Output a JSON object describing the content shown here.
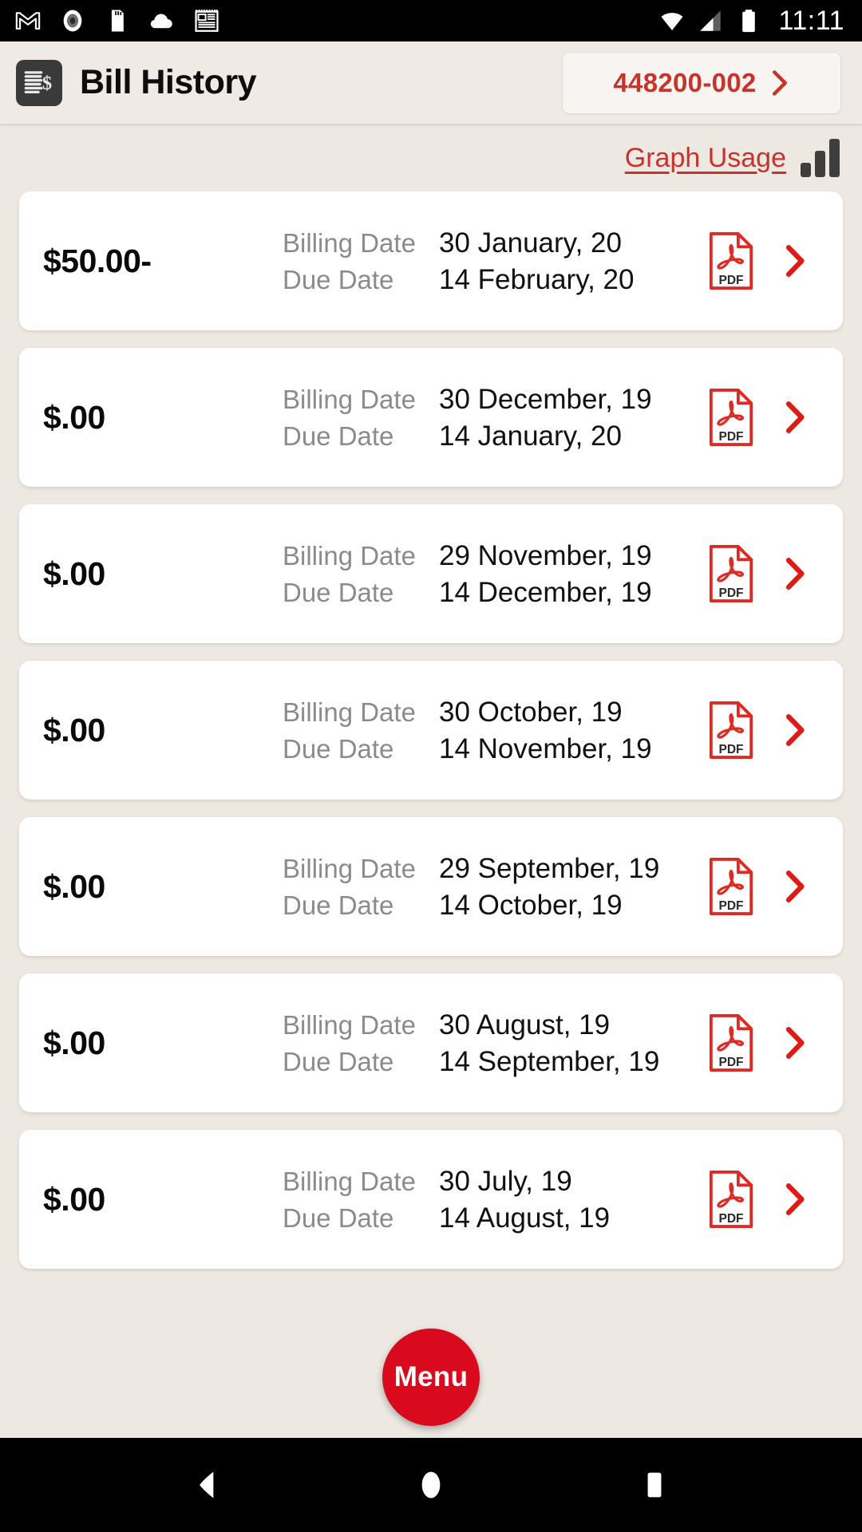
{
  "statusbar": {
    "time": "11:11",
    "left_icons": [
      "gmail-icon",
      "screen-record-icon",
      "sd-card-icon",
      "cloud-icon",
      "news-icon"
    ],
    "right_icons": [
      "wifi-icon",
      "cellular-signal-icon",
      "battery-icon"
    ]
  },
  "header": {
    "icon": "bill-document-icon",
    "title": "Bill History",
    "account_button": {
      "number": "448200-002",
      "chevron": "chevron-right-icon"
    }
  },
  "toolbar": {
    "graph_usage_label": "Graph Usage",
    "graph_icon": "bar-chart-icon"
  },
  "labels": {
    "billing_date": "Billing Date",
    "due_date": "Due Date",
    "pdf_icon": "pdf-file-icon",
    "row_chevron": "chevron-right-icon"
  },
  "bills": [
    {
      "amount": "$50.00-",
      "billing_date": "30 January, 20",
      "due_date": "14 February, 20"
    },
    {
      "amount": "$.00",
      "billing_date": "30 December, 19",
      "due_date": "14 January, 20"
    },
    {
      "amount": "$.00",
      "billing_date": "29 November, 19",
      "due_date": "14 December, 19"
    },
    {
      "amount": "$.00",
      "billing_date": "30 October, 19",
      "due_date": "14 November, 19"
    },
    {
      "amount": "$.00",
      "billing_date": "29 September, 19",
      "due_date": "14 October, 19"
    },
    {
      "amount": "$.00",
      "billing_date": "30 August, 19",
      "due_date": "14 September, 19"
    },
    {
      "amount": "$.00",
      "billing_date": "30 July, 19",
      "due_date": "14 August, 19"
    }
  ],
  "fab": {
    "label": "Menu"
  },
  "navbar": {
    "back": "back-triangle-icon",
    "home": "home-circle-icon",
    "recents": "recents-square-icon"
  },
  "colors": {
    "accent_red": "#C8342B",
    "fab_red": "#DA0A1E",
    "background": "#EDE8E2",
    "card": "#FFFFFF",
    "label_gray": "#8B8B8B"
  }
}
